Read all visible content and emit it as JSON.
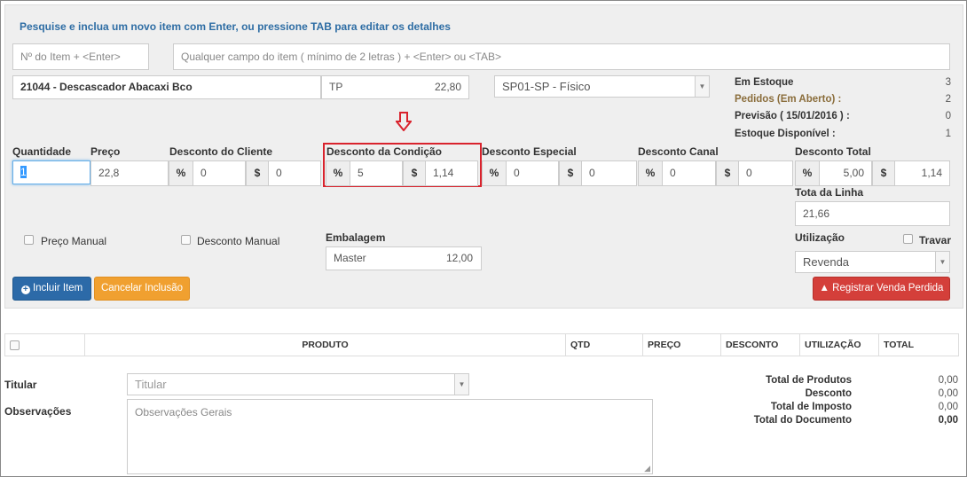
{
  "header": {
    "instruction": "Pesquise e inclua um novo item com Enter, ou pressione TAB para editar os detalhes"
  },
  "search": {
    "item_no_placeholder": "Nº do Item + <Enter>",
    "any_field_placeholder": "Qualquer campo do item ( mínimo de 2 letras ) + <Enter> ou <TAB>"
  },
  "item": {
    "name": "21044 - Descascador Abacaxi Bco",
    "price_table": "TP",
    "price_table_value": "22,80",
    "warehouse": "SP01-SP - Físico"
  },
  "stock": {
    "em_estoque_label": "Em Estoque",
    "em_estoque_value": "3",
    "pedidos_label": "Pedidos (Em Aberto) :",
    "pedidos_value": "2",
    "previsao_label": "Previsão ( 15/01/2016 ) :",
    "previsao_value": "0",
    "disponivel_label": "Estoque Disponível :",
    "disponivel_value": "1"
  },
  "fields": {
    "quantidade_label": "Quantidade",
    "quantidade_value": "1",
    "preco_label": "Preço",
    "preco_value": "22,8",
    "desc_cliente_label": "Desconto do Cliente",
    "desc_cliente_pct": "0",
    "desc_cliente_val": "0",
    "desc_condicao_label": "Desconto da Condição",
    "desc_condicao_pct": "5",
    "desc_condicao_val": "1,14",
    "desc_especial_label": "Desconto Especial",
    "desc_especial_pct": "0",
    "desc_especial_val": "0",
    "desc_canal_label": "Desconto Canal",
    "desc_canal_pct": "0",
    "desc_canal_val": "0",
    "desc_total_label": "Desconto Total",
    "desc_total_pct": "5,00",
    "desc_total_val": "1,14",
    "total_linha_label": "Tota da Linha",
    "total_linha_value": "21,66",
    "pct_symbol": "%",
    "cur_symbol": "$"
  },
  "options": {
    "preco_manual": "Preço Manual",
    "desconto_manual": "Desconto Manual",
    "embalagem_label": "Embalagem",
    "embalagem_name": "Master",
    "embalagem_value": "12,00",
    "utilizacao_label": "Utilização",
    "utilizacao_value": "Revenda",
    "travar": "Travar"
  },
  "buttons": {
    "incluir": "Incluir Item",
    "cancelar": "Cancelar Inclusão",
    "registrar": "Registrar Venda Perdida"
  },
  "table": {
    "columns": [
      "PRODUTO",
      "QTD",
      "PREÇO",
      "DESCONTO",
      "UTILIZAÇÃO",
      "TOTAL"
    ]
  },
  "footer": {
    "titular_label": "Titular",
    "titular_placeholder": "Titular",
    "observacoes_label": "Observações",
    "observacoes_placeholder": "Observações Gerais"
  },
  "totals": {
    "produtos_label": "Total de Produtos",
    "produtos_value": "0,00",
    "desconto_label": "Desconto",
    "desconto_value": "0,00",
    "imposto_label": "Total de Imposto",
    "imposto_value": "0,00",
    "documento_label": "Total do Documento",
    "documento_value": "0,00"
  },
  "colors": {
    "highlight": "#d9232d",
    "accent": "#2e6da4"
  }
}
